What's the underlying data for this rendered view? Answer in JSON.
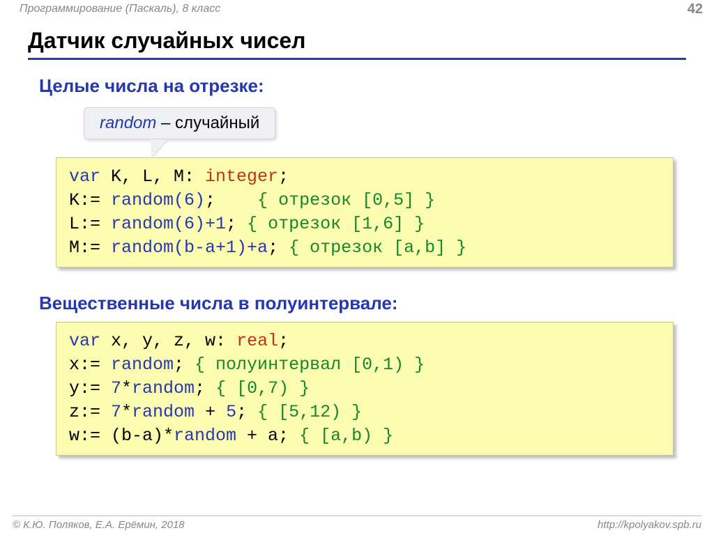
{
  "header": {
    "topic": "Программирование (Паскаль), 8 класс",
    "page": "42"
  },
  "title": "Датчик случайных чисел",
  "sub1": "Целые числа на отрезке:",
  "callout": {
    "kw": "random",
    "rest": " – случайный"
  },
  "code1": {
    "l1": {
      "a": "var",
      "b": " K, L, M: ",
      "c": "integer",
      "d": ";"
    },
    "l2": {
      "a": "K:= ",
      "b": "random(6)",
      "c": ";    ",
      "d": "{ отрезок [0,5] }"
    },
    "l3": {
      "a": "L:= ",
      "b": "random(6)+1",
      "c": "; ",
      "d": "{ отрезок [1,6] }"
    },
    "l4": {
      "a": "M:= ",
      "b": "random(b-a+1)+a",
      "c": "; ",
      "d": "{ отрезок [a,b] }"
    }
  },
  "sub2": "Вещественные числа в полуинтервале:",
  "code2": {
    "l1": {
      "a": "var",
      "b": " x, y, z, w: ",
      "c": "real",
      "d": ";"
    },
    "l2": {
      "a": "x:= ",
      "b": "random",
      "c": "; ",
      "d": "{ полуинтервал [0,1) }"
    },
    "l3": {
      "a": "y:= ",
      "b": "7",
      "c": "*",
      "d": "random",
      "e": "; ",
      "f": "{ [0,7) }"
    },
    "l4": {
      "a": "z:= ",
      "b": "7",
      "c": "*",
      "d": "random",
      "e": " + ",
      "f": "5",
      "g": "; ",
      "h": "{ [5,12) }"
    },
    "l5": {
      "a": "w:= ",
      "b": "(b-a)*",
      "c": "random",
      "d": " + a; ",
      "e": "{ [a,b) }"
    }
  },
  "footer": {
    "left": "© К.Ю. Поляков, Е.А. Ерёмин, 2018",
    "right": "http://kpolyakov.spb.ru"
  }
}
